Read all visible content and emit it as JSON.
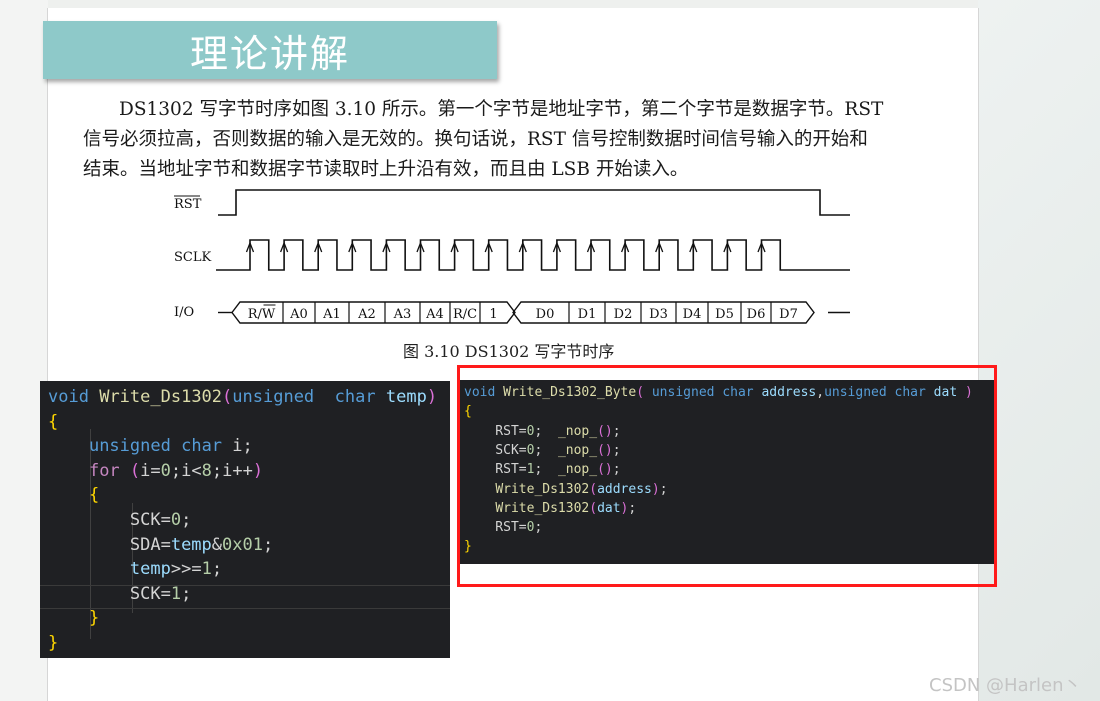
{
  "banner": {
    "title": "理论讲解"
  },
  "paragraph": {
    "line1": "DS1302 写字节时序如图 3.10 所示。第一个字节是地址字节，第二个字节是数据字节。RST",
    "line2": "信号必须拉高，否则数据的输入是无效的。换句话说，RST 信号控制数据时间信号输入的开始和",
    "line3": "结束。当地址字节和数据字节读取时上升沿有效，而且由 LSB 开始读入。"
  },
  "timing": {
    "signals": {
      "rst": "RST",
      "sclk": "SCLK",
      "io": "I/O"
    },
    "rst_level": "active-high-frame",
    "sclk_pulses": 16,
    "io_cells": [
      "R/W",
      "A0",
      "A1",
      "A2",
      "A3",
      "A4",
      "R/C",
      "1",
      "D0",
      "D1",
      "D2",
      "D3",
      "D4",
      "D5",
      "D6",
      "D7"
    ],
    "caption": "图 3.10    DS1302 写字节时序"
  },
  "code_left": {
    "lines": [
      "void Write_Ds1302(unsigned  char temp)",
      "{",
      "    unsigned char i;",
      "    for (i=0;i<8;i++)",
      "    {",
      "        SCK=0;",
      "        SDA=temp&0x01;",
      "        temp>>=1;",
      "        SCK=1;",
      "    }",
      "}"
    ]
  },
  "code_right": {
    "lines": [
      "void Write_Ds1302_Byte( unsigned char address,unsigned char dat )",
      "{",
      "    RST=0;  _nop_();",
      "    SCK=0;  _nop_();",
      "    RST=1;  _nop_();",
      "    Write_Ds1302(address);",
      "    Write_Ds1302(dat);",
      "    RST=0;",
      "}"
    ]
  },
  "highlight_color": "#ff1a1a",
  "banner_color": "#8ec9c9",
  "watermark": "CSDN @Harlen丶"
}
